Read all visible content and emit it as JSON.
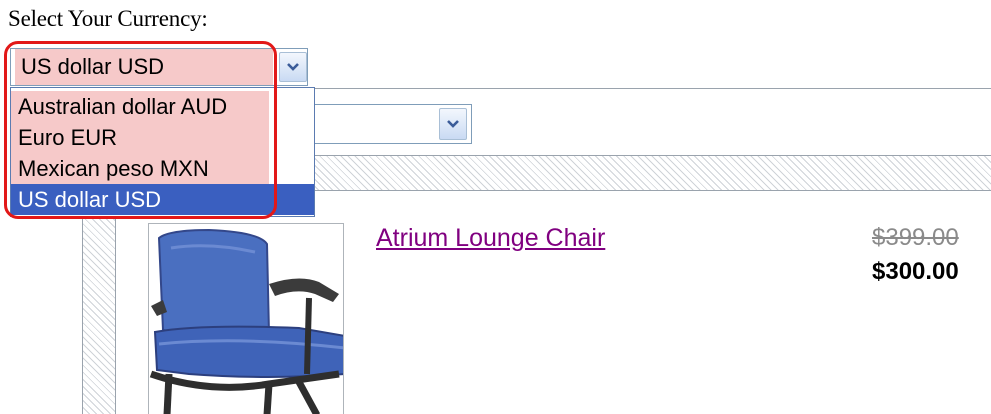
{
  "currency_label": "Select Your Currency:",
  "currency_select": {
    "selected": "US dollar USD",
    "options": [
      {
        "label": "Australian dollar AUD"
      },
      {
        "label": "Euro EUR"
      },
      {
        "label": "Mexican peso MXN"
      },
      {
        "label": "US dollar USD"
      }
    ]
  },
  "product": {
    "name": "Atrium Lounge Chair",
    "original_price": "$399.00",
    "sale_price": "$300.00"
  },
  "icons": {
    "dropdown": "chevron-down-icon",
    "product_image": "lounge-chair-image"
  },
  "colors": {
    "highlight": "#e21818",
    "option_highlight_bg": "#f6c9c9",
    "selected_option_bg": "#3a5fc0",
    "link": "#800080"
  }
}
